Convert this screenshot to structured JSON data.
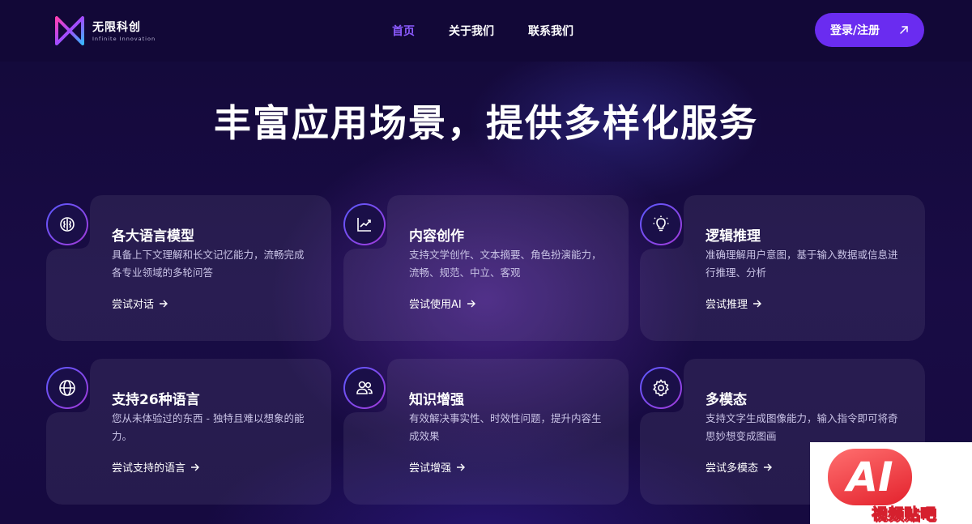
{
  "brand": {
    "name": "无限科创",
    "subtitle": "Infinite Innovation"
  },
  "nav": {
    "items": [
      {
        "label": "首页",
        "active": true
      },
      {
        "label": "关于我们",
        "active": false
      },
      {
        "label": "联系我们",
        "active": false
      }
    ],
    "login_label": "登录/注册",
    "login_icon": "arrow-up-right-icon"
  },
  "hero": {
    "title": "丰富应用场景，提供多样化服务"
  },
  "cards": [
    {
      "icon": "brain-icon",
      "title": "各大语言模型",
      "desc": "具备上下文理解和长文记忆能力，流畅完成各专业领域的多轮问答",
      "link": "尝试对话"
    },
    {
      "icon": "chart-trend-icon",
      "title": "内容创作",
      "desc": "支持文学创作、文本摘要、角色扮演能力，流畅、规范、中立、客观",
      "link": "尝试使用AI"
    },
    {
      "icon": "lightbulb-icon",
      "title": "逻辑推理",
      "desc": "准确理解用户意图，基于输入数据或信息进行推理、分析",
      "link": "尝试推理"
    },
    {
      "icon": "globe-icon",
      "title": "支持26种语言",
      "desc": "您从未体验过的东西 - 独特且难以想象的能力。",
      "link": "尝试支持的语言"
    },
    {
      "icon": "users-icon",
      "title": "知识增强",
      "desc": "有效解决事实性、时效性问题，提升内容生成效果",
      "link": "尝试增强"
    },
    {
      "icon": "gear-icon",
      "title": "多模态",
      "desc": "支持文字生成图像能力，输入指令即可将奇思妙想变成图画",
      "link": "尝试多模态"
    }
  ],
  "watermark": {
    "badge": "AI",
    "text": "视频贴吧"
  },
  "colors": {
    "background": "#150a3d",
    "accent": "#6a2cf0",
    "nav_active": "#8c5bff"
  }
}
